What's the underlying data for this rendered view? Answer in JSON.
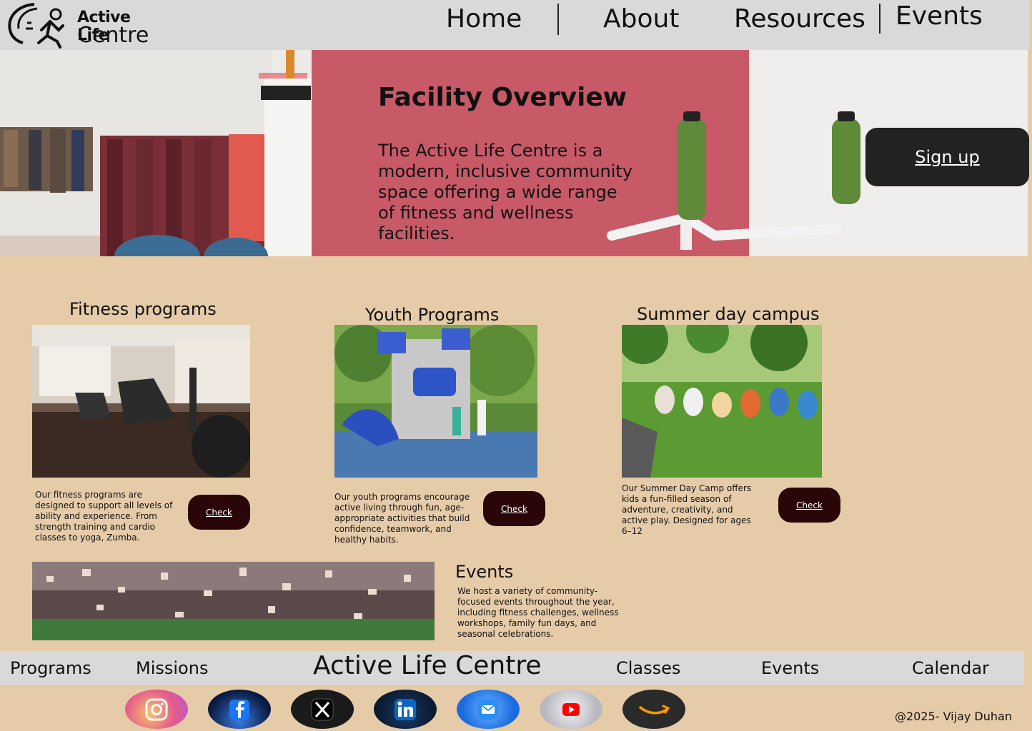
{
  "header": {
    "logo_line1": "Active Life",
    "logo_line2": "Centre",
    "nav": [
      "Home",
      "About",
      "Resources",
      "Events"
    ]
  },
  "hero": {
    "title": "Facility Overview",
    "text": "The Active Life Centre is a modern, inclusive community space offering a wide range of fitness and wellness facilities.",
    "signup_label": "Sign up"
  },
  "programs": [
    {
      "title": "Fitness programs",
      "description": "Our fitness programs are designed to support all levels of ability and experience. From strength training and cardio classes to yoga, Zumba.",
      "button": "Check"
    },
    {
      "title": "Youth Programs",
      "description": "Our youth programs encourage active living through fun, age-appropriate activities that build confidence, teamwork, and healthy habits.",
      "button": "Check"
    },
    {
      "title": "Summer day campus",
      "description": "Our Summer Day Camp offers kids a fun-filled season of adventure, creativity, and active play. Designed for ages 6–12",
      "button": "Check"
    }
  ],
  "events": {
    "title": "Events",
    "description": "We host a variety of community-focused events throughout the year, including fitness challenges, wellness workshops, family fun days, and seasonal celebrations."
  },
  "footer": {
    "links": [
      "Programs",
      "Missions",
      "Classes",
      "Events",
      "Calendar"
    ],
    "brand": "Active Life Centre",
    "copyright": "@2025- Vijay Duhan",
    "social_icons": [
      "instagram-icon",
      "facebook-icon",
      "x-icon",
      "linkedin-icon",
      "mail-icon",
      "youtube-icon",
      "amazon-icon"
    ]
  },
  "colors": {
    "page_bg": "#e6cba9",
    "header_bg": "#d9d9d9",
    "signup_bg": "#222222",
    "check_bg": "#2a0608",
    "hero_pink": "#c85a68"
  }
}
